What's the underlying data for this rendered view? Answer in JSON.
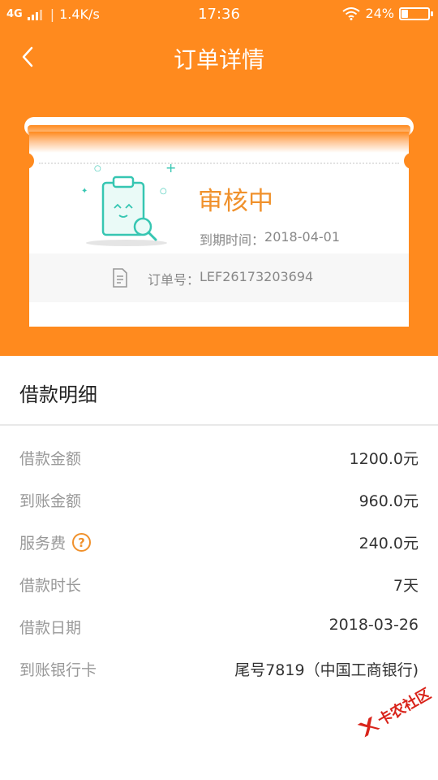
{
  "status_bar": {
    "network": "4G",
    "speed": "1.4K/s",
    "time": "17:36",
    "battery": "24%",
    "battery_level": 0.24
  },
  "header": {
    "title": "订单详情"
  },
  "order_card": {
    "status": "审核中",
    "deadline_label": "到期时间：",
    "deadline_value": "2018-04-01",
    "order_no_label": "订单号：",
    "order_no_value": "LEF26173203694"
  },
  "loan_details": {
    "title": "借款明细",
    "rows": [
      {
        "label": "借款金额",
        "value": "1200.0元"
      },
      {
        "label": "到账金额",
        "value": "960.0元"
      },
      {
        "label": "服务费",
        "value": "240.0元",
        "help": "?"
      },
      {
        "label": "借款时长",
        "value": "7天"
      },
      {
        "label": "借款日期",
        "value": "2018-03-26"
      },
      {
        "label": "到账银行卡",
        "value": "尾号7819（中国工商银行)"
      }
    ]
  },
  "watermark": {
    "text": "卡农社区"
  },
  "colors": {
    "brand_orange": "#ff8a1e",
    "status_orange": "#f0912c",
    "illustration_teal": "#36c6b2"
  }
}
